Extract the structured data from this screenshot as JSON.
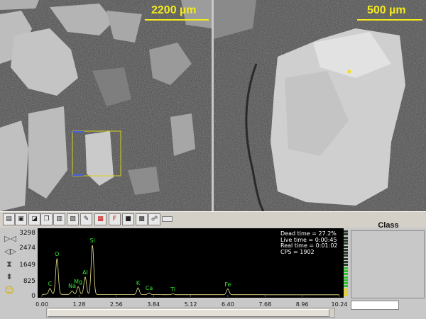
{
  "sem_images": {
    "left": {
      "scale_label": "2200 µm"
    },
    "right": {
      "scale_label": "500 µm"
    }
  },
  "toolbar": {
    "buttons": [
      {
        "name": "open-icon",
        "glyph": "▤"
      },
      {
        "name": "save-icon",
        "glyph": "▣"
      },
      {
        "name": "print-preview-icon",
        "glyph": "◪"
      },
      {
        "name": "copy-icon",
        "glyph": "❐"
      },
      {
        "name": "print-icon",
        "glyph": "▥"
      },
      {
        "name": "folder-icon",
        "glyph": "▧"
      },
      {
        "name": "edit-icon",
        "glyph": "✎"
      },
      {
        "name": "report-icon",
        "glyph": "▦"
      },
      {
        "name": "flag-icon",
        "glyph": "F"
      },
      {
        "name": "stop-icon",
        "glyph": "■"
      },
      {
        "name": "grid-icon",
        "glyph": "▩"
      },
      {
        "name": "network-icon",
        "glyph": "☍"
      },
      {
        "name": "blank-icon",
        "glyph": ""
      }
    ]
  },
  "spectrum": {
    "stats": {
      "dead_time": "Dead time = 27.2%",
      "live_time": "Live time = 0:00:45",
      "real_time": "Real time = 0:01:02",
      "cps": "CPS = 1902"
    },
    "y_ticks": [
      "3298",
      "2474",
      "1649",
      "825",
      "0"
    ],
    "x_ticks": [
      "0.00",
      "1.28",
      "2.56",
      "3.84",
      "5.12",
      "6.40",
      "7.68",
      "8.96",
      "10.24"
    ],
    "peaks": [
      {
        "label": "C",
        "energy": 0.28,
        "counts": 300
      },
      {
        "label": "O",
        "energy": 0.52,
        "counts": 1850
      },
      {
        "label": "Na",
        "energy": 1.04,
        "counts": 180
      },
      {
        "label": "Mg",
        "energy": 1.25,
        "counts": 400
      },
      {
        "label": "Al",
        "energy": 1.49,
        "counts": 900
      },
      {
        "label": "Si",
        "energy": 1.74,
        "counts": 2550
      },
      {
        "label": "K",
        "energy": 3.31,
        "counts": 350
      },
      {
        "label": "Ca",
        "energy": 3.69,
        "counts": 90
      },
      {
        "label": "Ti",
        "energy": 4.51,
        "counts": 40
      },
      {
        "label": "Fe",
        "energy": 6.4,
        "counts": 300
      }
    ],
    "x_max": 10.24,
    "y_max": 3298,
    "trace_color": "#f0e68c",
    "label_color": "#33e633"
  },
  "class_panel": {
    "title": "Class"
  },
  "left_controls": [
    {
      "name": "zoom-in-x-icon",
      "glyph": "▷◁"
    },
    {
      "name": "zoom-out-x-icon",
      "glyph": "◁▷"
    },
    {
      "name": "zoom-in-y-icon",
      "glyph": "⧗"
    },
    {
      "name": "zoom-out-y-icon",
      "glyph": "⬍"
    },
    {
      "name": "smiley-icon",
      "glyph": "☺"
    }
  ]
}
